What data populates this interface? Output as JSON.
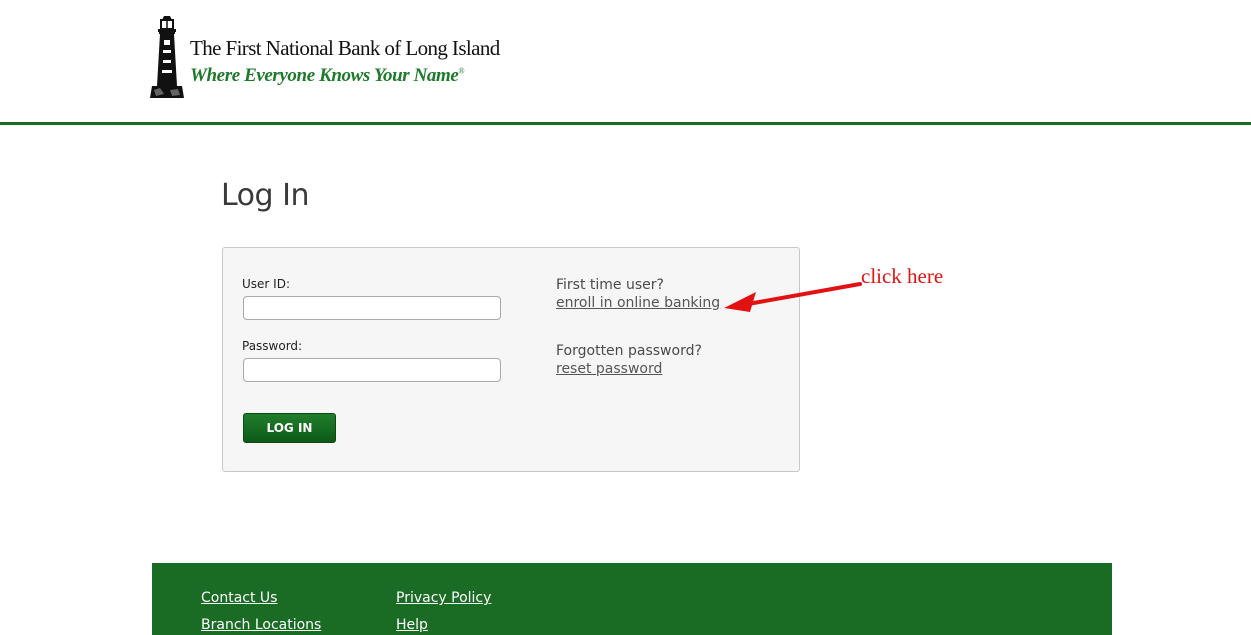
{
  "header": {
    "bank_name": "The First National Bank of Long Island",
    "tagline": "Where Everyone Knows Your Name",
    "trademark": "®",
    "logo_icon": "lighthouse-icon"
  },
  "main": {
    "title": "Log In"
  },
  "login_form": {
    "user_id_label": "User ID:",
    "user_id_value": "",
    "password_label": "Password:",
    "password_value": "",
    "login_button": "LOG IN"
  },
  "side_links": {
    "first_time_heading": "First time user?",
    "enroll_link": "enroll in online banking",
    "forgot_heading": "Forgotten password?",
    "reset_link": "reset password"
  },
  "annotation": {
    "text": "click here",
    "arrow_icon": "red-arrow-icon",
    "color": "#e31212"
  },
  "footer": {
    "col1": [
      "Contact Us",
      "Branch Locations"
    ],
    "col2": [
      "Privacy Policy",
      "Help"
    ]
  },
  "colors": {
    "brand_green": "#1a6b23",
    "tagline_green": "#1e7a2b",
    "panel_bg": "#f6f6f6"
  }
}
